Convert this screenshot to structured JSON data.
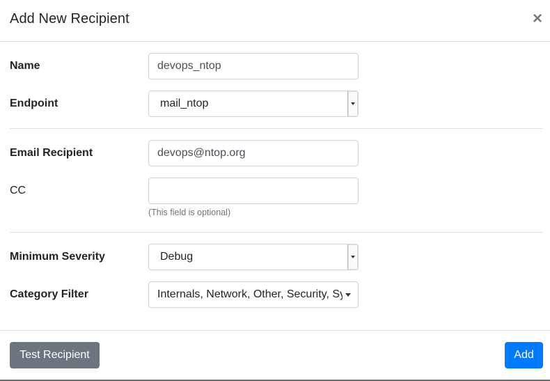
{
  "modal": {
    "title": "Add New Recipient",
    "close_symbol": "×"
  },
  "form": {
    "name": {
      "label": "Name",
      "value": "devops_ntop"
    },
    "endpoint": {
      "label": "Endpoint",
      "value": "mail_ntop"
    },
    "email_recipient": {
      "label": "Email Recipient",
      "value": "devops@ntop.org"
    },
    "cc": {
      "label": "CC",
      "value": "",
      "hint": "(This field is optional)"
    },
    "minimum_severity": {
      "label": "Minimum Severity",
      "value": "Debug"
    },
    "category_filter": {
      "label": "Category Filter",
      "value": "Internals, Network, Other, Security, System"
    }
  },
  "footer": {
    "test_label": "Test Recipient",
    "add_label": "Add"
  },
  "colors": {
    "primary": "#007bff",
    "secondary": "#6c757d",
    "border": "#ced4da",
    "divider": "#dee2e6"
  }
}
